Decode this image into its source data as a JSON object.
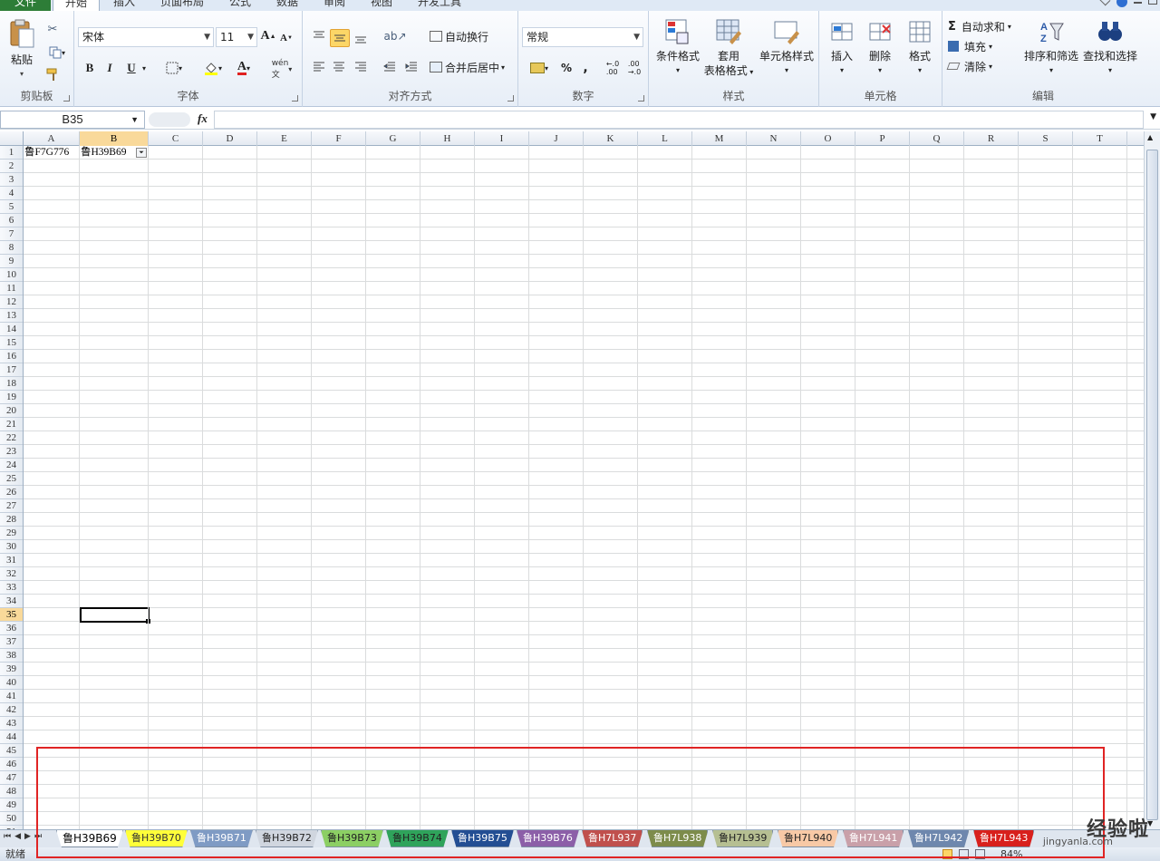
{
  "ribbon_tabs": [
    "文件",
    "开始",
    "插入",
    "页面布局",
    "公式",
    "数据",
    "审阅",
    "视图",
    "开发工具"
  ],
  "active_tab": "开始",
  "clipboard": {
    "paste_label": "粘贴",
    "group": "剪贴板"
  },
  "font": {
    "name": "宋体",
    "size": "11",
    "group": "字体",
    "bold": "B",
    "italic": "I",
    "underline": "U"
  },
  "alignment": {
    "wrap": "自动换行",
    "merge": "合并后居中",
    "group": "对齐方式"
  },
  "number": {
    "format": "常规",
    "percent": "%",
    "comma": ",",
    "group": "数字"
  },
  "styles": {
    "conditional": "条件格式",
    "table_l1": "套用",
    "table_l2": "表格格式",
    "cell_styles": "单元格样式",
    "group": "样式"
  },
  "cells_group": {
    "insert": "插入",
    "delete": "删除",
    "format": "格式",
    "group": "单元格"
  },
  "editing": {
    "autosum": "自动求和",
    "fill": "填充",
    "clear": "清除",
    "sort": "排序和筛选",
    "find": "查找和选择",
    "group": "编辑"
  },
  "formula_bar": {
    "name_box": "B35",
    "fx": "fx",
    "formula": ""
  },
  "columns": [
    "A",
    "B",
    "C",
    "D",
    "E",
    "F",
    "G",
    "H",
    "I",
    "J",
    "K",
    "L",
    "M",
    "N",
    "O",
    "P",
    "Q",
    "R",
    "S",
    "T"
  ],
  "selected_column": "B",
  "selected_row": "35",
  "cells": {
    "A1": "鲁F7G776",
    "B1": "鲁H39B69"
  },
  "sheet_tabs": [
    {
      "name": "鲁H39B69",
      "color": "#ffffff",
      "text": "#000",
      "active": true
    },
    {
      "name": "鲁H39B70",
      "color": "#ffff3a",
      "text": "#333"
    },
    {
      "name": "鲁H39B71",
      "color": "#7f9bc4",
      "text": "#fff"
    },
    {
      "name": "鲁H39B72",
      "color": "#d0d6df",
      "text": "#222"
    },
    {
      "name": "鲁H39B73",
      "color": "#8ccf64",
      "text": "#222"
    },
    {
      "name": "鲁H39B74",
      "color": "#2fa35b",
      "text": "#222"
    },
    {
      "name": "鲁H39B75",
      "color": "#234e93",
      "text": "#fff"
    },
    {
      "name": "鲁H39B76",
      "color": "#8c5fa8",
      "text": "#fff"
    },
    {
      "name": "鲁H7L937",
      "color": "#c0504d",
      "text": "#fff"
    },
    {
      "name": "鲁H7L938",
      "color": "#7d8c4b",
      "text": "#fff"
    },
    {
      "name": "鲁H7L939",
      "color": "#b6bf92",
      "text": "#222"
    },
    {
      "name": "鲁H7L940",
      "color": "#f8c9a6",
      "text": "#222"
    },
    {
      "name": "鲁H7L941",
      "color": "#c9a0a9",
      "text": "#fff"
    },
    {
      "name": "鲁H7L942",
      "color": "#6e87ad",
      "text": "#fff"
    },
    {
      "name": "鲁H7L943",
      "color": "#d8201c",
      "text": "#fff"
    }
  ],
  "status": {
    "ready": "就绪",
    "zoom": "84%"
  },
  "watermark": {
    "main": "经验啦",
    "sub": "jingyanla.com"
  }
}
